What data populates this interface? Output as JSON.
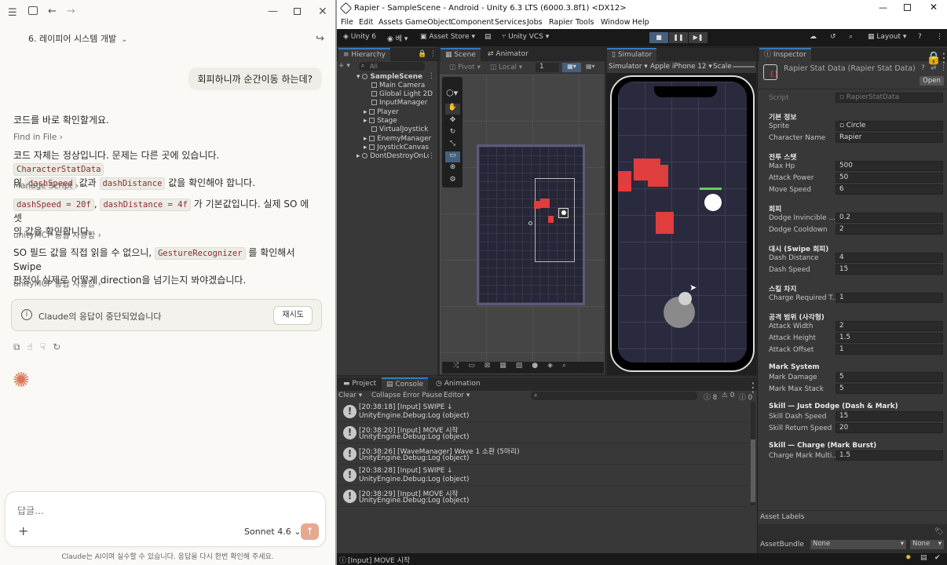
{
  "claude": {
    "chat_title": "6. 레이피어 시스템 개발",
    "user_message": "회피하니까 순간이동 하는데?",
    "p1": "코드를 바로 확인할게요.",
    "tool1": "Find in File",
    "p2_a": "코드 자체는 정상입니다. 문제는 다른 곳에 있습니다.",
    "p2_code1": "CharacterStatData",
    "p2_b": "의",
    "p2_code2": "dashSpeed",
    "p2_c": "값과",
    "p2_code3": "dashDistance",
    "p2_d": "값을 확인해야 합니다.",
    "tool2": "Manage Script",
    "p3_code1": "dashSpeed = 20f",
    "p3_sep": ",",
    "p3_code2": "dashDistance = 4f",
    "p3_a": "가 기본값입니다. 실제 SO 에셋",
    "p3_b": "의 값을 확인합니다.",
    "tool3": "unityMCP 통합 사용함",
    "p4_a": "SO 필드 값을 직접 읽을 수 없으니,",
    "p4_code": "GestureRecognizer",
    "p4_b": "를 확인해서 Swipe",
    "p4_c": "판정이 실제로 어떻게 direction을 넘기는지 봐야겠습니다.",
    "tool4": "unityMCP 통합 사용함",
    "stopped_notice": "Claude의 응답이 중단되었습니다",
    "retry_label": "재시도",
    "input_placeholder": "답글...",
    "model_label": "Sonnet 4.6",
    "disclaimer": "Claude는 AI이며 실수할 수 있습니다. 응답을 다시 한번 확인해 주세요."
  },
  "unity": {
    "window_title": "Rapier - SampleScene - Android - Unity 6.3 LTS (6000.3.8f1) <DX12>",
    "menu": [
      "File",
      "Edit",
      "Assets",
      "GameObject",
      "Component",
      "Services",
      "Jobs",
      "Rapier",
      "Tools",
      "Window",
      "Help"
    ],
    "toolbar": {
      "unity6": "Unity 6",
      "account": "베",
      "asset_store": "Asset Store",
      "vcs": "Unity VCS",
      "layout": "Layout"
    },
    "tabs": {
      "hierarchy": "Hierarchy",
      "scene": "Scene",
      "animator": "Animator",
      "simulator": "Simulator",
      "inspector": "Inspector",
      "project": "Project",
      "console": "Console",
      "animation": "Animation"
    },
    "hierarchy": {
      "search_placeholder": "All",
      "scene_name": "SampleScene",
      "items": [
        "Main Camera",
        "Global Light 2D",
        "InputManager",
        "Player",
        "Stage",
        "VirtualJoystick",
        "EnemyManager",
        "JoystickCanvas"
      ],
      "ddol": "DontDestroyOnLoad"
    },
    "scene_toolbar": {
      "pivot": "Pivot",
      "local": "Local",
      "grid_value": "1"
    },
    "simulator_toolbar": {
      "simulator": "Simulator",
      "device": "Apple iPhone 12",
      "scale": "Scale"
    },
    "console": {
      "clear": "Clear",
      "collapse": "Collapse",
      "error_pause": "Error Pause",
      "editor": "Editor",
      "count_warn": "8",
      "count_info": "0",
      "count_err": "0",
      "logs": [
        {
          "msg": "[20:38:18] [Input] SWIPE ↓",
          "src": "UnityEngine.Debug:Log (object)"
        },
        {
          "msg": "[20:38:20] [Input] MOVE 시작",
          "src": "UnityEngine.Debug:Log (object)"
        },
        {
          "msg": "[20:38:26] [WaveManager] Wave 1 소환 (5마리)",
          "src": "UnityEngine.Debug:Log (object)"
        },
        {
          "msg": "[20:38:28] [Input] SWIPE ↓",
          "src": "UnityEngine.Debug:Log (object)"
        },
        {
          "msg": "[20:38:29] [Input] MOVE 시작",
          "src": "UnityEngine.Debug:Log (object)"
        }
      ]
    },
    "inspector": {
      "title": "Rapier Stat Data (Rapier Stat Data)",
      "open": "Open",
      "script_label": "Script",
      "script_value": "RapierStatData",
      "sections": [
        {
          "header": "기본 정보",
          "fields": [
            {
              "label": "Sprite",
              "value": "Circle"
            },
            {
              "label": "Character Name",
              "value": "Rapier"
            }
          ]
        },
        {
          "header": "전투 스탯",
          "fields": [
            {
              "label": "Max Hp",
              "value": "500"
            },
            {
              "label": "Attack Power",
              "value": "50"
            },
            {
              "label": "Move Speed",
              "value": "6"
            }
          ]
        },
        {
          "header": "회피",
          "fields": [
            {
              "label": "Dodge Invincible ...",
              "value": "0.2"
            },
            {
              "label": "Dodge Cooldown",
              "value": "2"
            }
          ]
        },
        {
          "header": "대시 (Swipe 회피)",
          "fields": [
            {
              "label": "Dash Distance",
              "value": "4"
            },
            {
              "label": "Dash Speed",
              "value": "15"
            }
          ]
        },
        {
          "header": "스킬 차지",
          "fields": [
            {
              "label": "Charge Required T...",
              "value": "1"
            }
          ]
        },
        {
          "header": "공격 범위 (사각형)",
          "fields": [
            {
              "label": "Attack Width",
              "value": "2"
            },
            {
              "label": "Attack Height",
              "value": "1.5"
            },
            {
              "label": "Attack Offset",
              "value": "1"
            }
          ]
        },
        {
          "header": "Mark System",
          "fields": [
            {
              "label": "Mark Damage",
              "value": "5"
            },
            {
              "label": "Mark Max Stack",
              "value": "5"
            }
          ]
        },
        {
          "header": "Skill — Just Dodge (Dash & Mark)",
          "fields": [
            {
              "label": "Skill Dash Speed",
              "value": "15"
            },
            {
              "label": "Skill Return Speed",
              "value": "20"
            }
          ]
        },
        {
          "header": "Skill — Charge (Mark Burst)",
          "fields": [
            {
              "label": "Charge Mark Multi...",
              "value": "1.5"
            }
          ]
        }
      ],
      "asset_labels": "Asset Labels",
      "asset_bundle": "AssetBundle",
      "asset_bundle_value": "None",
      "asset_bundle_variant": "None"
    },
    "status_message": "[Input] MOVE 시작"
  }
}
